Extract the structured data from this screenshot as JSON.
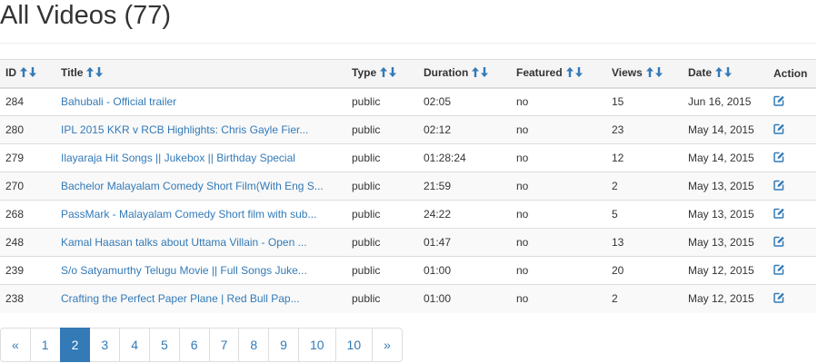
{
  "header": {
    "title": "All Videos (77)"
  },
  "colors": {
    "link": "#337ab7",
    "sort_arrow": "#337ab7",
    "active_page_bg": "#337ab7",
    "header_bg": "#f5f5f5",
    "stripe_bg": "#f9f9f9",
    "border": "#dddddd"
  },
  "icons": {
    "sort_ascending": "arrow-up-icon",
    "sort_descending": "arrow-down-icon",
    "edit": "edit-icon"
  },
  "table": {
    "columns": [
      {
        "key": "id",
        "label": "ID",
        "sortable": true
      },
      {
        "key": "title",
        "label": "Title",
        "sortable": true
      },
      {
        "key": "type",
        "label": "Type",
        "sortable": true
      },
      {
        "key": "duration",
        "label": "Duration",
        "sortable": true
      },
      {
        "key": "featured",
        "label": "Featured",
        "sortable": true
      },
      {
        "key": "views",
        "label": "Views",
        "sortable": true
      },
      {
        "key": "date",
        "label": "Date",
        "sortable": true
      },
      {
        "key": "action",
        "label": "Action",
        "sortable": false
      }
    ],
    "rows": [
      {
        "id": "284",
        "title": "Bahubali - Official trailer",
        "type": "public",
        "duration": "02:05",
        "featured": "no",
        "views": "15",
        "date": "Jun 16, 2015"
      },
      {
        "id": "280",
        "title": "IPL 2015 KKR v RCB Highlights: Chris Gayle Fier...",
        "type": "public",
        "duration": "02:12",
        "featured": "no",
        "views": "23",
        "date": "May 14, 2015"
      },
      {
        "id": "279",
        "title": "Ilayaraja Hit Songs || Jukebox || Birthday Special",
        "type": "public",
        "duration": "01:28:24",
        "featured": "no",
        "views": "12",
        "date": "May 14, 2015"
      },
      {
        "id": "270",
        "title": "Bachelor Malayalam Comedy Short Film(With Eng S...",
        "type": "public",
        "duration": "21:59",
        "featured": "no",
        "views": "2",
        "date": "May 13, 2015"
      },
      {
        "id": "268",
        "title": "PassMark - Malayalam Comedy Short film with sub...",
        "type": "public",
        "duration": "24:22",
        "featured": "no",
        "views": "5",
        "date": "May 13, 2015"
      },
      {
        "id": "248",
        "title": "Kamal Haasan talks about Uttama Villain - Open ...",
        "type": "public",
        "duration": "01:47",
        "featured": "no",
        "views": "13",
        "date": "May 13, 2015"
      },
      {
        "id": "239",
        "title": "S/o Satyamurthy Telugu Movie || Full Songs Juke...",
        "type": "public",
        "duration": "01:00",
        "featured": "no",
        "views": "20",
        "date": "May 12, 2015"
      },
      {
        "id": "238",
        "title": "Crafting the Perfect Paper Plane | Red Bull Pap...",
        "type": "public",
        "duration": "01:00",
        "featured": "no",
        "views": "2",
        "date": "May 12, 2015"
      }
    ]
  },
  "pagination": {
    "items": [
      "«",
      "1",
      "2",
      "3",
      "4",
      "5",
      "6",
      "7",
      "8",
      "9",
      "10",
      "10",
      "»"
    ],
    "active_label": "2"
  }
}
